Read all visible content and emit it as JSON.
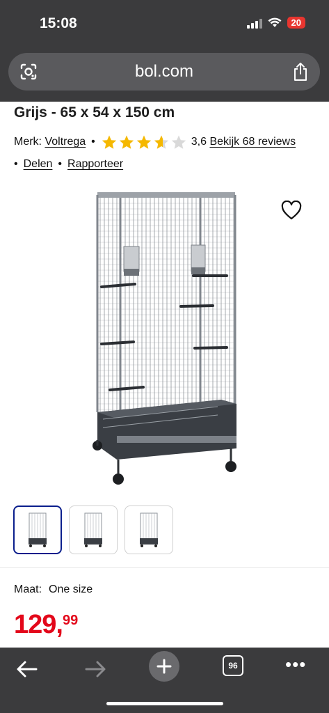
{
  "status": {
    "time": "15:08",
    "battery": "20"
  },
  "browser": {
    "url": "bol.com",
    "tab_count": "96"
  },
  "product": {
    "title": "Grijs - 65 x 54 x 150 cm",
    "brand_label": "Merk:",
    "brand": "Voltrega",
    "rating_value": 3.6,
    "rating_text": "3,6",
    "reviews_link": "Bekijk 68 reviews",
    "share_link": "Delen",
    "report_link": "Rapporteer",
    "size_label": "Maat:",
    "size_value": "One size",
    "price_int": "129,",
    "price_dec": "99"
  },
  "colors": {
    "price": "#e3071a",
    "star": "#f5b800",
    "star_empty": "#d9d9d9",
    "thumb_active": "#0a1e8c",
    "chrome": "#3b3b3d"
  },
  "icons": [
    "lens-icon",
    "share-icon",
    "heart-icon",
    "star-icon",
    "back-arrow-icon",
    "forward-arrow-icon",
    "plus-icon",
    "tabs-icon",
    "more-icon"
  ]
}
